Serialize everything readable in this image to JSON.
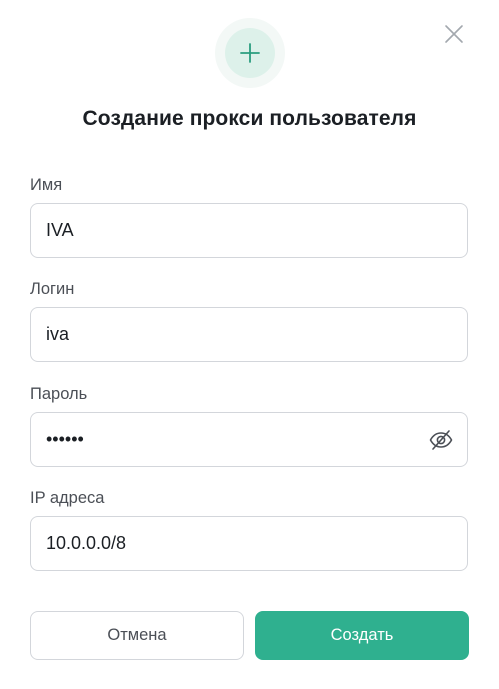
{
  "dialog": {
    "title": "Создание прокси пользователя",
    "close_icon": "close-icon",
    "header_icon": "plus-icon"
  },
  "fields": {
    "name": {
      "label": "Имя",
      "value": "IVA"
    },
    "login": {
      "label": "Логин",
      "value": "iva"
    },
    "password": {
      "label": "Пароль",
      "value": "••••••",
      "toggle_icon": "eye-off-icon"
    },
    "ip": {
      "label": "IP адреса",
      "value": "10.0.0.0/8"
    }
  },
  "actions": {
    "cancel_label": "Отмена",
    "create_label": "Создать"
  },
  "colors": {
    "accent": "#2fb08f",
    "accent_light": "#ddf1ea",
    "border": "#d3d6db",
    "text": "#1b1f24",
    "label": "#4b4f56"
  }
}
